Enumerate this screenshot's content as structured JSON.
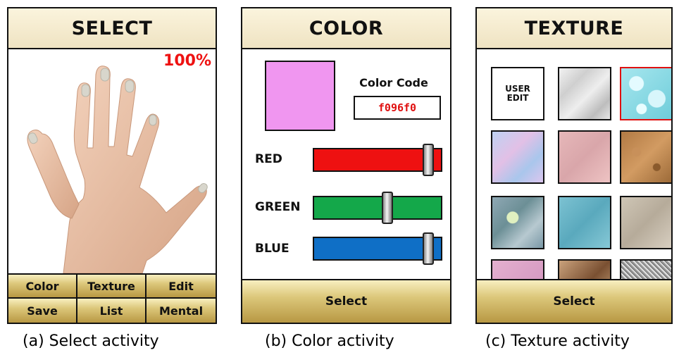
{
  "select_panel": {
    "title": "SELECT",
    "zoom": "100%",
    "buttons": [
      "Color",
      "Texture",
      "Edit",
      "Save",
      "List",
      "Mental"
    ]
  },
  "color_panel": {
    "title": "COLOR",
    "color_code_label": "Color Code",
    "color_code": "f096f0",
    "swatch_color": "#f096f0",
    "sliders": [
      {
        "label": "RED",
        "color": "#ee1111",
        "value": 240
      },
      {
        "label": "GREEN",
        "color": "#14a84a",
        "value": 150
      },
      {
        "label": "BLUE",
        "color": "#0f6fc6",
        "value": 240
      }
    ],
    "select_label": "Select"
  },
  "texture_panel": {
    "title": "TEXTURE",
    "user_edit_label": [
      "USER",
      "EDIT"
    ],
    "select_label": "Select",
    "selected_tile": "water-texture"
  },
  "captions": [
    "(a) Select activity",
    "(b) Color activity",
    "(c) Texture activity"
  ]
}
